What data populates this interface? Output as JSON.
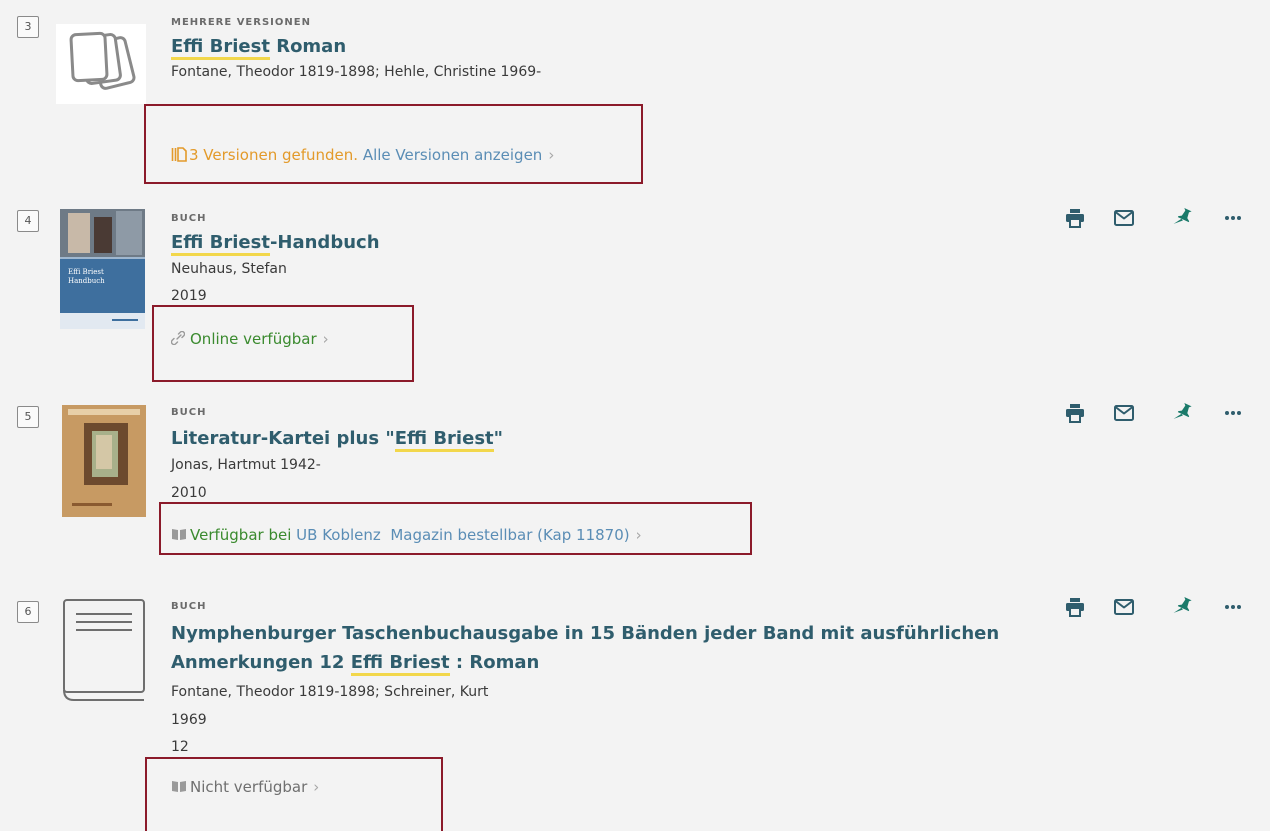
{
  "results": [
    {
      "number": "3",
      "type": "MEHRERE VERSIONEN",
      "title_hl": "Effi Briest",
      "title_rest": " Roman",
      "authors": "Fontane, Theodor 1819-1898; Hehle, Christine 1969-",
      "availability": {
        "icon": "versions-icon",
        "status": "3 Versionen gefunden.",
        "link": "Alle Versionen anzeigen"
      }
    },
    {
      "number": "4",
      "type": "BUCH",
      "title_hl": "Effi Briest",
      "title_rest": "-Handbuch",
      "authors": "Neuhaus, Stefan",
      "year": "2019",
      "cover": {
        "series": "Effi Briest",
        "subtitle": "Handbuch"
      },
      "availability": {
        "icon": "link-icon",
        "status": "Online verfügbar"
      }
    },
    {
      "number": "5",
      "type": "BUCH",
      "title_prefix": "Literatur-Kartei plus \"",
      "title_hl": "Effi Briest",
      "title_suffix": "\"",
      "authors": "Jonas, Hartmut 1942-",
      "year": "2010",
      "availability": {
        "icon": "book-open-icon",
        "status": "Verfügbar bei",
        "library": "UB Koblenz",
        "location": "Magazin bestellbar (Kap 11870)"
      }
    },
    {
      "number": "6",
      "type": "BUCH",
      "title_line1": "Nymphenburger Taschenbuchausgabe in 15 Bänden jeder Band mit ausführlichen",
      "title_line2_prefix": "Anmerkungen 12 ",
      "title_hl": "Effi Briest",
      "title_line2_suffix": " : Roman",
      "authors": "Fontane, Theodor 1819-1898; Schreiner, Kurt",
      "year": "1969",
      "volume": "12",
      "availability": {
        "icon": "book-open-icon",
        "status": "Nicht verfügbar"
      }
    }
  ],
  "actions": {
    "print": "print-icon",
    "email": "mail-icon",
    "pin": "pin-icon",
    "more": "more-icon"
  },
  "colors": {
    "title": "#2f5d6d",
    "highlight": "#f2d74b",
    "available": "#3a8a2e",
    "versions": "#e39a2a",
    "link": "#5a8db5",
    "annotation_box": "#8b1a2a",
    "action_icon": "#2f5d6d",
    "pin": "#1a7a6a"
  }
}
